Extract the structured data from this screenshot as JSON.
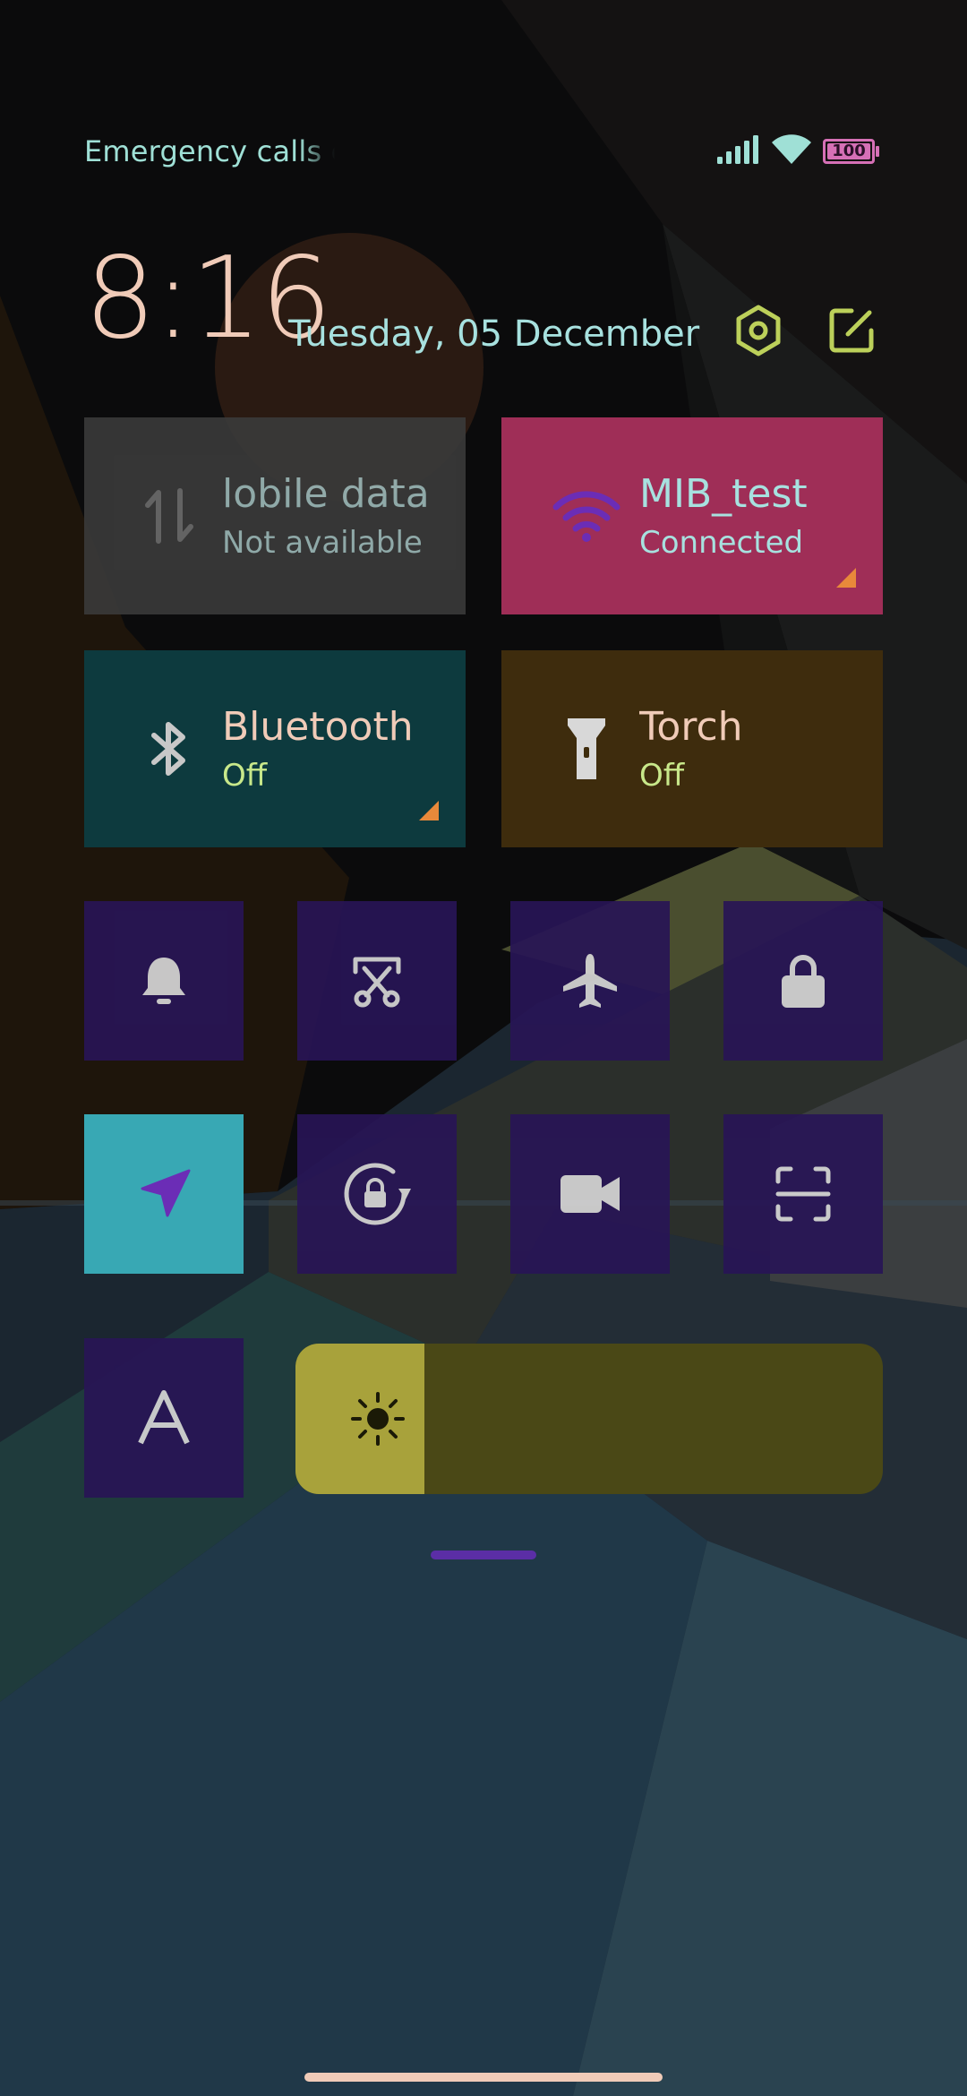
{
  "status_bar": {
    "carrier_text": "Emergency calls o",
    "battery_level": "100",
    "battery_fraction": 1.0,
    "icons": [
      "signal-icon",
      "wifi-icon",
      "battery-icon"
    ]
  },
  "header": {
    "time": "8:16",
    "date": "Tuesday, 05 December",
    "settings_icon": "hexagon-settings-icon",
    "edit_icon": "edit-icon"
  },
  "big_tiles": [
    {
      "key": "mobile-data",
      "title": "lobile data",
      "subtitle": "Not available",
      "icon": "mobile-data-icon",
      "active": false
    },
    {
      "key": "wifi",
      "title": "MIB_test",
      "subtitle": "Connected",
      "icon": "wifi-icon",
      "active": true
    },
    {
      "key": "bluetooth",
      "title": "Bluetooth",
      "subtitle": "Off",
      "icon": "bluetooth-icon",
      "active": false
    },
    {
      "key": "torch",
      "title": "Torch",
      "subtitle": "Off",
      "icon": "torch-icon",
      "active": false
    }
  ],
  "small_tiles": [
    {
      "key": "ring",
      "icon": "bell-icon",
      "active": false
    },
    {
      "key": "screenshot",
      "icon": "scissors-screenshot-icon",
      "active": false
    },
    {
      "key": "airplane",
      "icon": "airplane-icon",
      "active": false
    },
    {
      "key": "lock",
      "icon": "lock-icon",
      "active": false
    },
    {
      "key": "location",
      "icon": "location-arrow-icon",
      "active": true
    },
    {
      "key": "rotation-lock",
      "icon": "rotation-lock-icon",
      "active": false
    },
    {
      "key": "screen-recorder",
      "icon": "video-camera-icon",
      "active": false
    },
    {
      "key": "scanner",
      "icon": "scan-icon",
      "active": false
    },
    {
      "key": "font",
      "icon": "font-a-icon",
      "active": false
    }
  ],
  "brightness": {
    "level_fraction": 0.22,
    "icon": "sun-icon"
  },
  "colors": {
    "tile_inactive": "#281556",
    "tile_active_location": "#38a8b4",
    "wifi_tile": "#9f2e57",
    "mobile_tile": "#3a3a3a",
    "bluetooth_tile": "#0d3a3e",
    "torch_tile": "#3e2c0d",
    "accent_text": "#a7e1df"
  }
}
